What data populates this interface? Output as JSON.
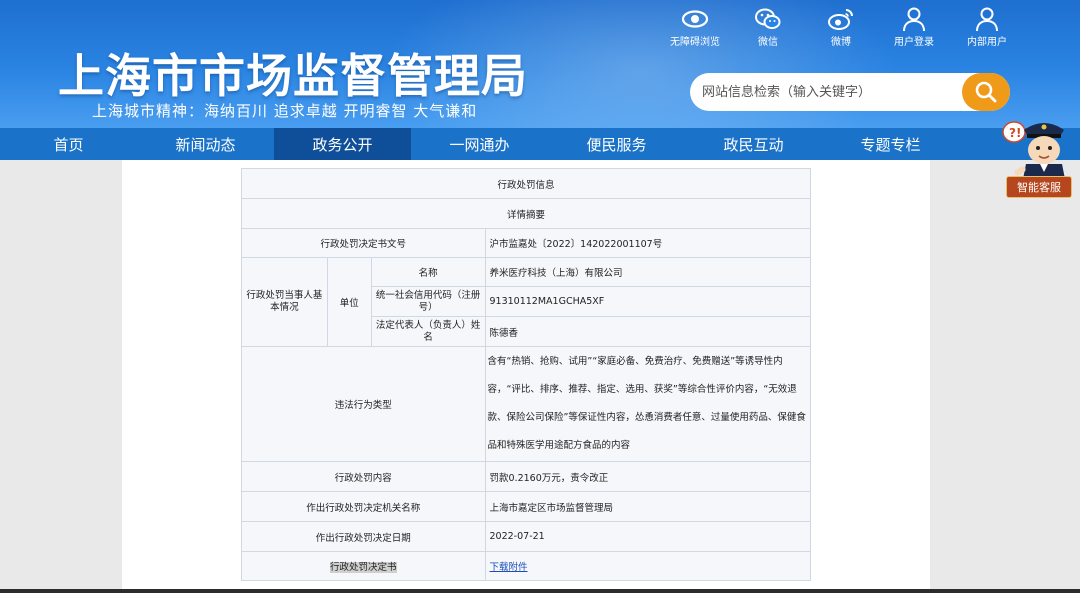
{
  "header": {
    "site_title": "上海市市场监督管理局",
    "slogan": "上海城市精神：海纳百川   追求卓越   开明睿智   大气谦和",
    "top_links": [
      {
        "label": "无障碍浏览",
        "icon": "eye-icon"
      },
      {
        "label": "微信",
        "icon": "wechat-icon"
      },
      {
        "label": "微博",
        "icon": "weibo-icon"
      },
      {
        "label": "用户登录",
        "icon": "user-icon"
      },
      {
        "label": "内部用户",
        "icon": "user-icon"
      }
    ],
    "search": {
      "placeholder": "网站信息检索（输入关键字）",
      "icon": "search-icon"
    }
  },
  "nav": {
    "items": [
      "首页",
      "新闻动态",
      "政务公开",
      "一网通办",
      "便民服务",
      "政民互动",
      "专题专栏"
    ],
    "active": "政务公开"
  },
  "service": {
    "label": "智能客服",
    "icon": "police-mascot-icon"
  },
  "colors": {
    "header_blue": "#2a84e2",
    "nav_blue": "#1a72c9",
    "nav_active": "#0f4f9a",
    "search_orange": "#f09a1a"
  },
  "table": {
    "title": "行政处罚信息",
    "subtitle": "详情摘要",
    "doc_no_label": "行政处罚决定书文号",
    "doc_no_value": "沪市监嘉处〔2022〕142022001107号",
    "party_label": "行政处罚当事人基本情况",
    "unit_label": "单位",
    "name_label": "名称",
    "name_value": "养米医疗科技（上海）有限公司",
    "credit_label": "统一社会信用代码（注册号）",
    "credit_value": "91310112MA1GCHA5XF",
    "rep_label": "法定代表人（负责人）姓名",
    "rep_value": "陈德香",
    "violation_label": "违法行为类型",
    "violation_value": "含有“热销、抢购、试用”“家庭必备、免费治疗、免费赠送”等诱导性内容，“评比、排序、推荐、指定、选用、获奖”等综合性评价内容，“无效退款、保险公司保险”等保证性内容，怂恿消费者任意、过量使用药品、保健食品和特殊医学用途配方食品的内容",
    "penalty_label": "行政处罚内容",
    "penalty_value": "罚款0.2160万元，责令改正",
    "authority_label": "作出行政处罚决定机关名称",
    "authority_value": "上海市嘉定区市场监督管理局",
    "date_label": "作出行政处罚决定日期",
    "date_value": "2022-07-21",
    "decision_label": "行政处罚决定书",
    "decision_link": "下载附件"
  }
}
